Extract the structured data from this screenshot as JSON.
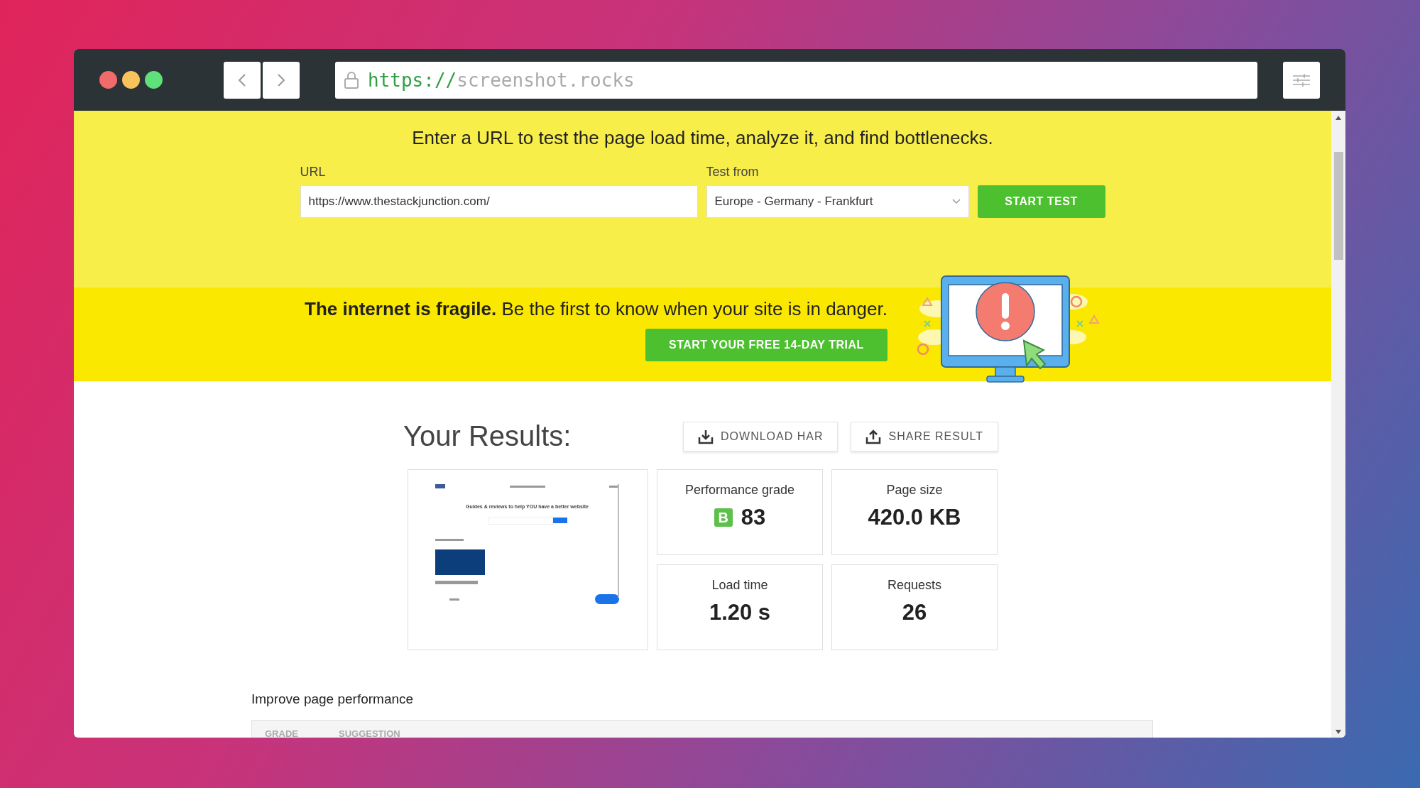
{
  "browser": {
    "url_scheme": "https://",
    "url_host": "screenshot.rocks"
  },
  "hero": {
    "headline": "Enter a URL to test the page load time, analyze it, and find bottlenecks.",
    "url_field": {
      "label": "URL",
      "value": "https://www.thestackjunction.com/"
    },
    "location_field": {
      "label": "Test from",
      "value": "Europe - Germany - Frankfurt"
    },
    "start_button": "START TEST"
  },
  "banner": {
    "text": "**The internet is fragile.** Be the first to know when your site is in danger.",
    "trial_button": "START YOUR FREE 14-DAY TRIAL"
  },
  "results": {
    "title": "Your Results:",
    "actions": [
      {
        "kind": "download",
        "label": "DOWNLOAD HAR"
      },
      {
        "kind": "share",
        "label": "SHARE RESULT"
      }
    ],
    "thumbnail": {
      "headline": "Guides & reviews to help YOU have a better website"
    },
    "metrics": [
      {
        "label": "Performance grade",
        "grade": "B",
        "value": "83"
      },
      {
        "label": "Page size",
        "value": "420.0 KB"
      },
      {
        "label": "Load time",
        "value": "1.20 s"
      },
      {
        "label": "Requests",
        "value": "26"
      }
    ]
  },
  "improve": {
    "title": "Improve page performance",
    "columns": [
      "GRADE",
      "SUGGESTION"
    ]
  }
}
